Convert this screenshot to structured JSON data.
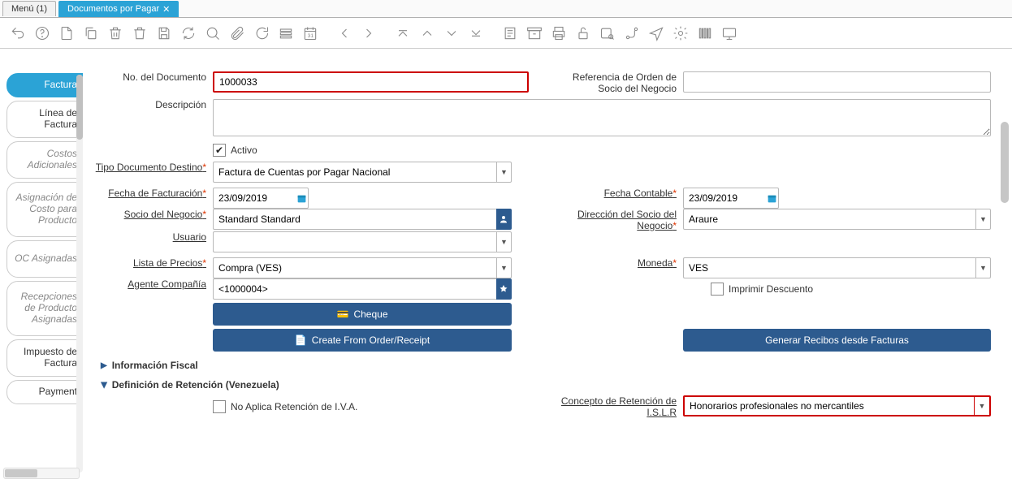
{
  "tabs": {
    "menu": "Menú (1)",
    "doc": "Documentos por Pagar"
  },
  "sidebar": {
    "items": [
      "Factura",
      "Línea de Factura",
      "Costos Adicionales",
      "Asignación de Costo para Producto",
      "OC Asignadas",
      "Recepciones de Producto Asignadas",
      "Impuesto de Factura",
      "Payment"
    ]
  },
  "labels": {
    "numDoc": "No. del Documento",
    "refOrden": "Referencia de Orden de Socio del Negocio",
    "descripcion": "Descripción",
    "activo": "Activo",
    "tipoDocDest": "Tipo Documento Destino",
    "fechaFact": "Fecha de Facturación",
    "fechaCont": "Fecha Contable",
    "socioNeg": "Socio del Negocio",
    "dirSocio": "Dirección del Socio del Negocio",
    "usuario": "Usuario",
    "listaPrecios": "Lista de Precios",
    "moneda": "Moneda",
    "agenteComp": "Agente Compañía",
    "imprimirDesc": "Imprimir Descuento",
    "cheque": "Cheque",
    "createFrom": "Create From Order/Receipt",
    "generarRecibos": "Generar Recibos desde Facturas",
    "infoFiscal": "Información Fiscal",
    "defRetencion": "Definición de Retención (Venezuela)",
    "noAplica": "No Aplica Retención de I.V.A.",
    "conceptoRet": "Concepto de Retención de I.S.L.R"
  },
  "values": {
    "numDoc": "1000033",
    "tipoDocDest": "Factura de Cuentas por Pagar Nacional",
    "fechaFact": "23/09/2019",
    "fechaCont": "23/09/2019",
    "socioNeg": "Standard Standard",
    "dirSocio": "Araure",
    "listaPrecios": "Compra (VES)",
    "moneda": "VES",
    "agenteComp": "<1000004>",
    "conceptoRet": "Honorarios profesionales no mercantiles"
  }
}
